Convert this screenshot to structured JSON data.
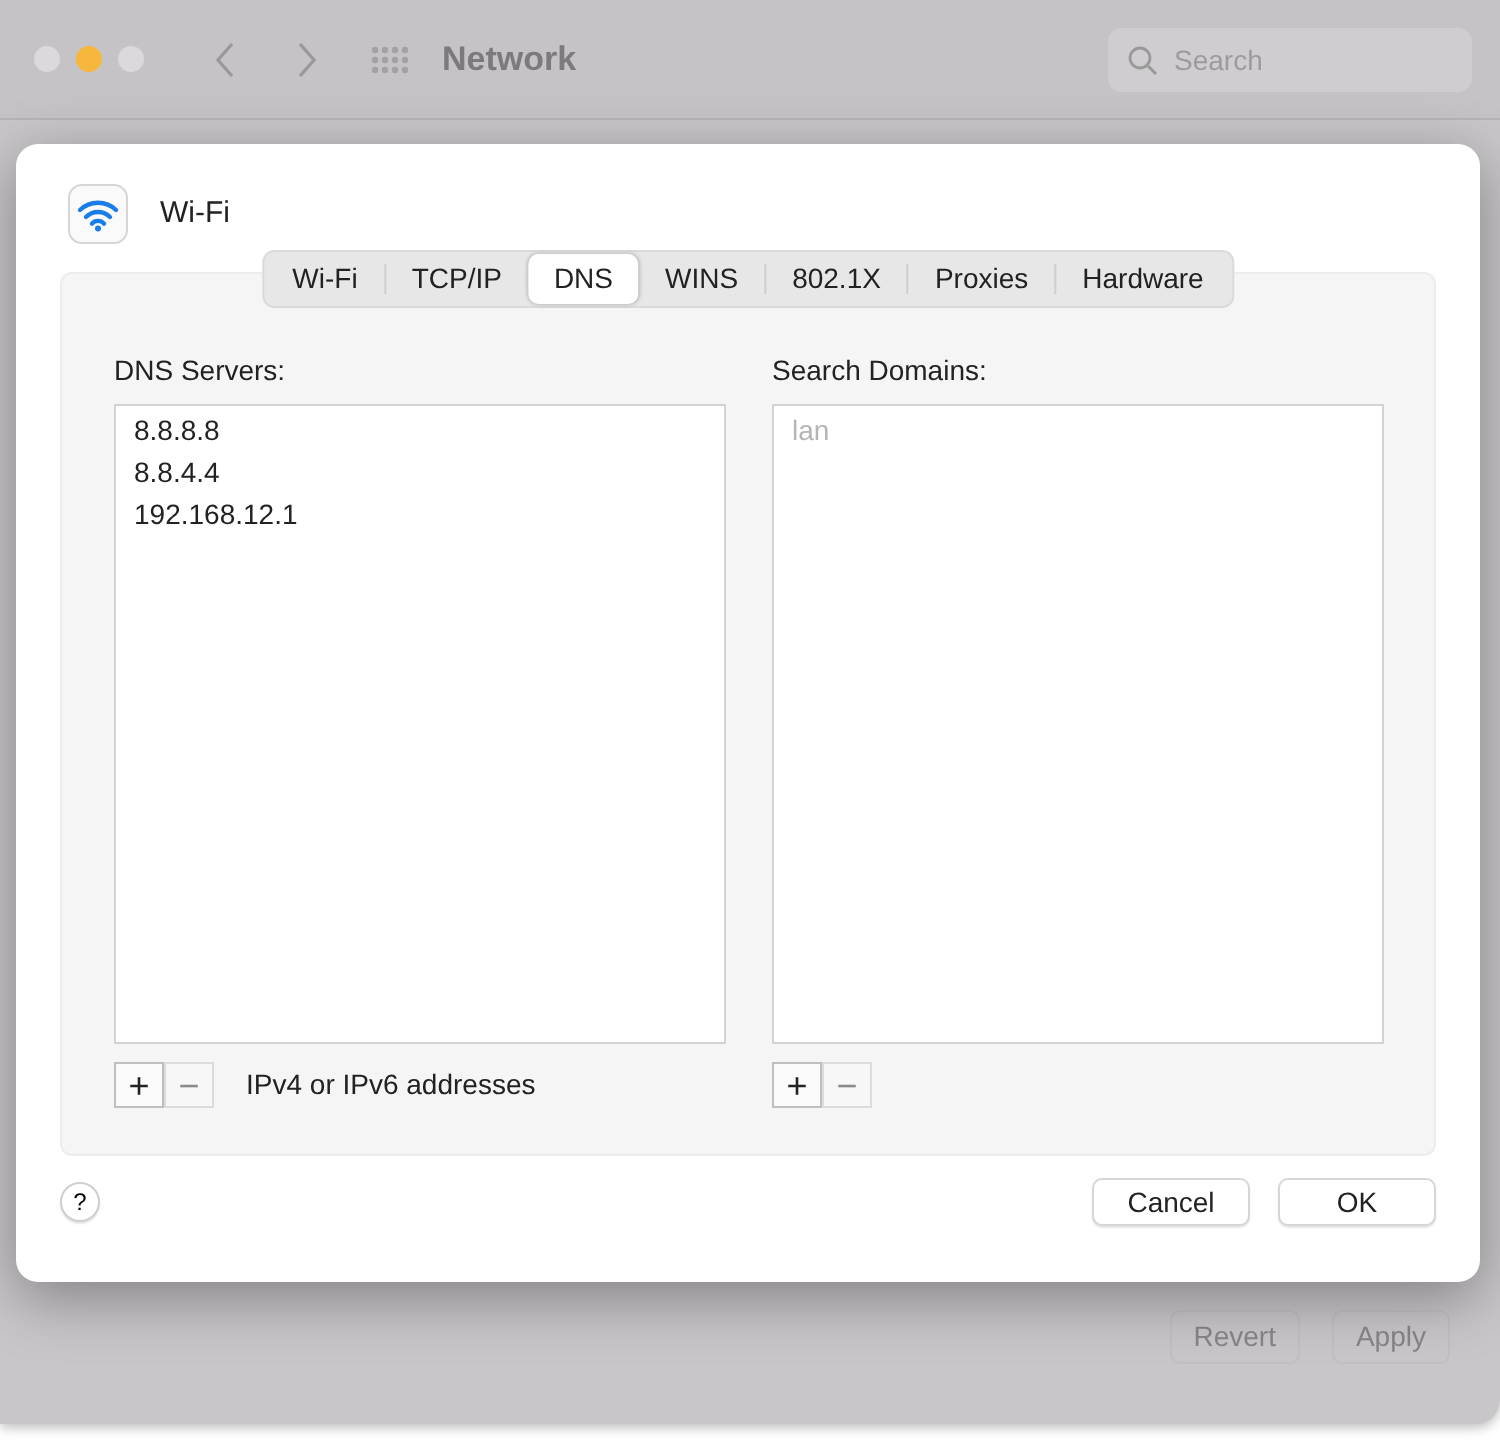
{
  "window": {
    "title": "Network",
    "search": {
      "placeholder": "Search"
    },
    "buttons": [
      {
        "label": "Revert",
        "disabled": true
      },
      {
        "label": "Apply",
        "disabled": true
      }
    ]
  },
  "sheet": {
    "service": "Wi-Fi",
    "tabs": [
      {
        "label": "Wi-Fi",
        "selected": false
      },
      {
        "label": "TCP/IP",
        "selected": false
      },
      {
        "label": "DNS",
        "selected": true
      },
      {
        "label": "WINS",
        "selected": false
      },
      {
        "label": "802.1X",
        "selected": false
      },
      {
        "label": "Proxies",
        "selected": false
      },
      {
        "label": "Hardware",
        "selected": false
      }
    ],
    "panels": [
      {
        "title": "DNS Servers:",
        "items": [
          "8.8.8.8",
          "8.8.4.4",
          "192.168.12.1"
        ],
        "add": {
          "label": "+",
          "disabled": false
        },
        "remove": {
          "label": "−",
          "disabled": true
        },
        "hint": "IPv4 or IPv6 addresses"
      },
      {
        "title": "Search Domains:",
        "placeholder": "lan",
        "add": {
          "label": "+",
          "disabled": false
        },
        "remove": {
          "label": "−",
          "disabled": true
        }
      }
    ],
    "help": "?",
    "buttons": [
      "Cancel",
      "OK"
    ]
  }
}
